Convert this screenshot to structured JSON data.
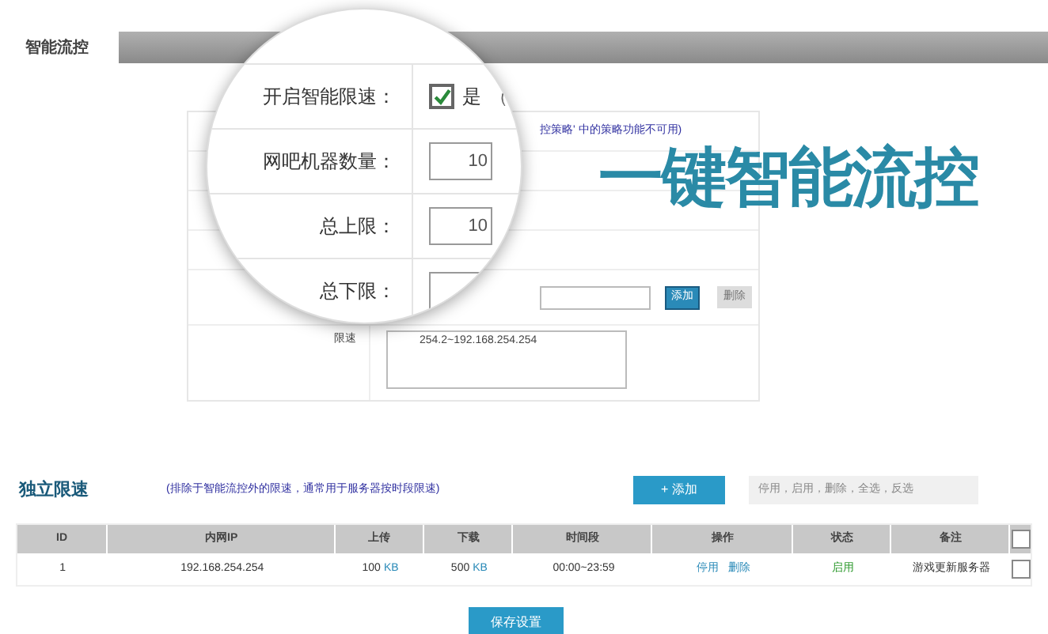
{
  "header": {
    "tab": "智能流控"
  },
  "form": {
    "note": "控策略' 中的策略功能不可用)",
    "add_button": "添加",
    "delete_button": "删除",
    "range_label": "限速",
    "range_value": "254.2~192.168.254.254"
  },
  "magnifier": {
    "rows": [
      {
        "kind": "checkbox",
        "label": "开启智能限速：",
        "checked": true,
        "option": "是",
        "note": "（"
      },
      {
        "kind": "input",
        "label": "网吧机器数量：",
        "value": "10"
      },
      {
        "kind": "input",
        "label": "总上限：",
        "value": "10"
      },
      {
        "kind": "input",
        "label": "总下限：",
        "value": ""
      }
    ]
  },
  "headline": "一键智能流控",
  "independent": {
    "title": "独立限速",
    "note": "(排除于智能流控外的限速，通常用于服务器按时段限速)",
    "add_button": "+ 添加",
    "actions": "停用，启用，删除，全选，反选"
  },
  "table": {
    "columns": [
      "ID",
      "内网IP",
      "上传",
      "下载",
      "时间段",
      "操作",
      "状态",
      "备注"
    ],
    "select_all": {
      "checked": false
    },
    "rows": [
      {
        "id": "1",
        "ip": "192.168.254.254",
        "upload": "100",
        "upload_unit": "KB",
        "download": "500",
        "download_unit": "KB",
        "time": "00:00~23:59",
        "actions": [
          "停用",
          "删除"
        ],
        "status": "启用",
        "color": "#2e9a2e",
        "note": "游戏更新服务器",
        "checked": false
      }
    ]
  },
  "save_button": "保存设置"
}
